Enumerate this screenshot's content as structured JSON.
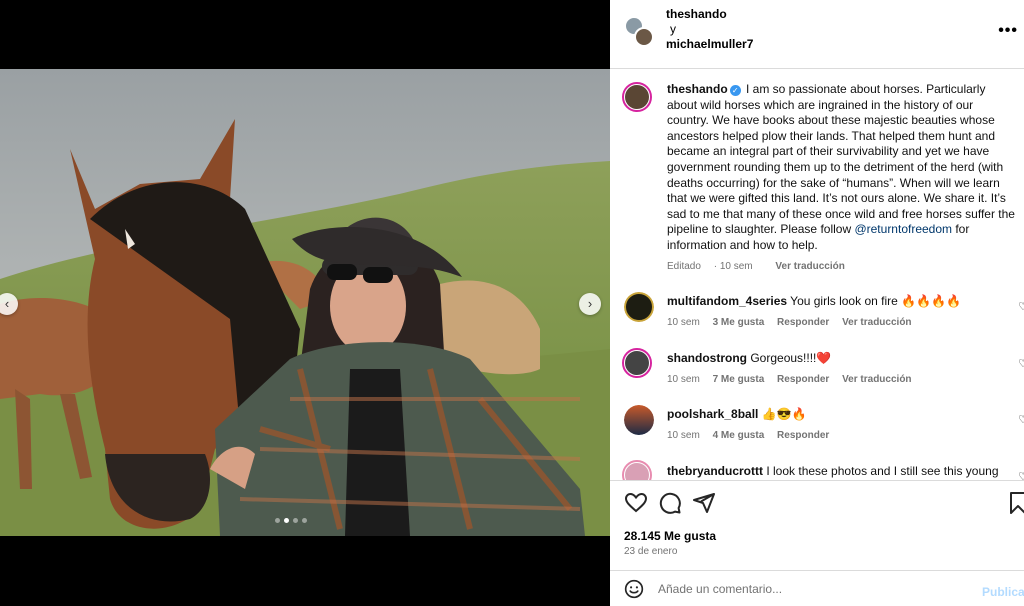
{
  "post": {
    "dots": 4,
    "active_dot": 1
  },
  "header": {
    "user1": "theshando",
    "separator": "y",
    "user2": "michaelmuller7",
    "more_icon": "more-horizontal-icon"
  },
  "caption": {
    "username": "theshando",
    "text_before_mention": " I am so passionate about horses. Particularly about wild horses which are ingrained in the history of our country. We have books about these majestic beauties whose ancestors helped plow their lands. That helped them hunt and became an integral part of their survivability and yet we have government rounding them up to the detriment of the herd (with deaths occurring) for the sake of “humans”. When will we learn that we were gifted this land. It’s not ours alone. We share it. It’s sad to me that many of these once wild and free horses suffer the pipeline to slaughter. Please follow ",
    "mention": "@returntofreedom",
    "text_after_mention": " for information and how to help.",
    "edited": "Editado",
    "time": "10 sem",
    "translate": "Ver traducción"
  },
  "comments": [
    {
      "username": "multifandom_4series",
      "text": "You girls look on fire 🔥🔥🔥🔥",
      "time": "10 sem",
      "likes": "3 Me gusta",
      "reply": "Responder",
      "translate": "Ver traducción",
      "avatar_color": "#1d1d12"
    },
    {
      "username": "shandostrong",
      "text": "Gorgeous!!!!❤️",
      "time": "10 sem",
      "likes": "7 Me gusta",
      "reply": "Responder",
      "translate": "Ver traducción",
      "avatar_color": "#444444"
    },
    {
      "username": "poolshark_8ball",
      "text": "👍😎🔥",
      "time": "10 sem",
      "likes": "4 Me gusta",
      "reply": "Responder",
      "translate": "",
      "avatar_color": "#c85a2a"
    },
    {
      "username": "thebryanducrottt",
      "text": "I look these photos and I still see this young",
      "avatar_color": "#d9a0b5"
    }
  ],
  "actions": {
    "likes": "28.145 Me gusta",
    "date": "23 de enero"
  },
  "add_comment": {
    "placeholder": "Añade un comentario...",
    "publish": "Publicar"
  },
  "colors": {
    "link": "#00376b",
    "muted": "#737373",
    "publish": "#b3dbff",
    "verified": "#3897f0"
  }
}
